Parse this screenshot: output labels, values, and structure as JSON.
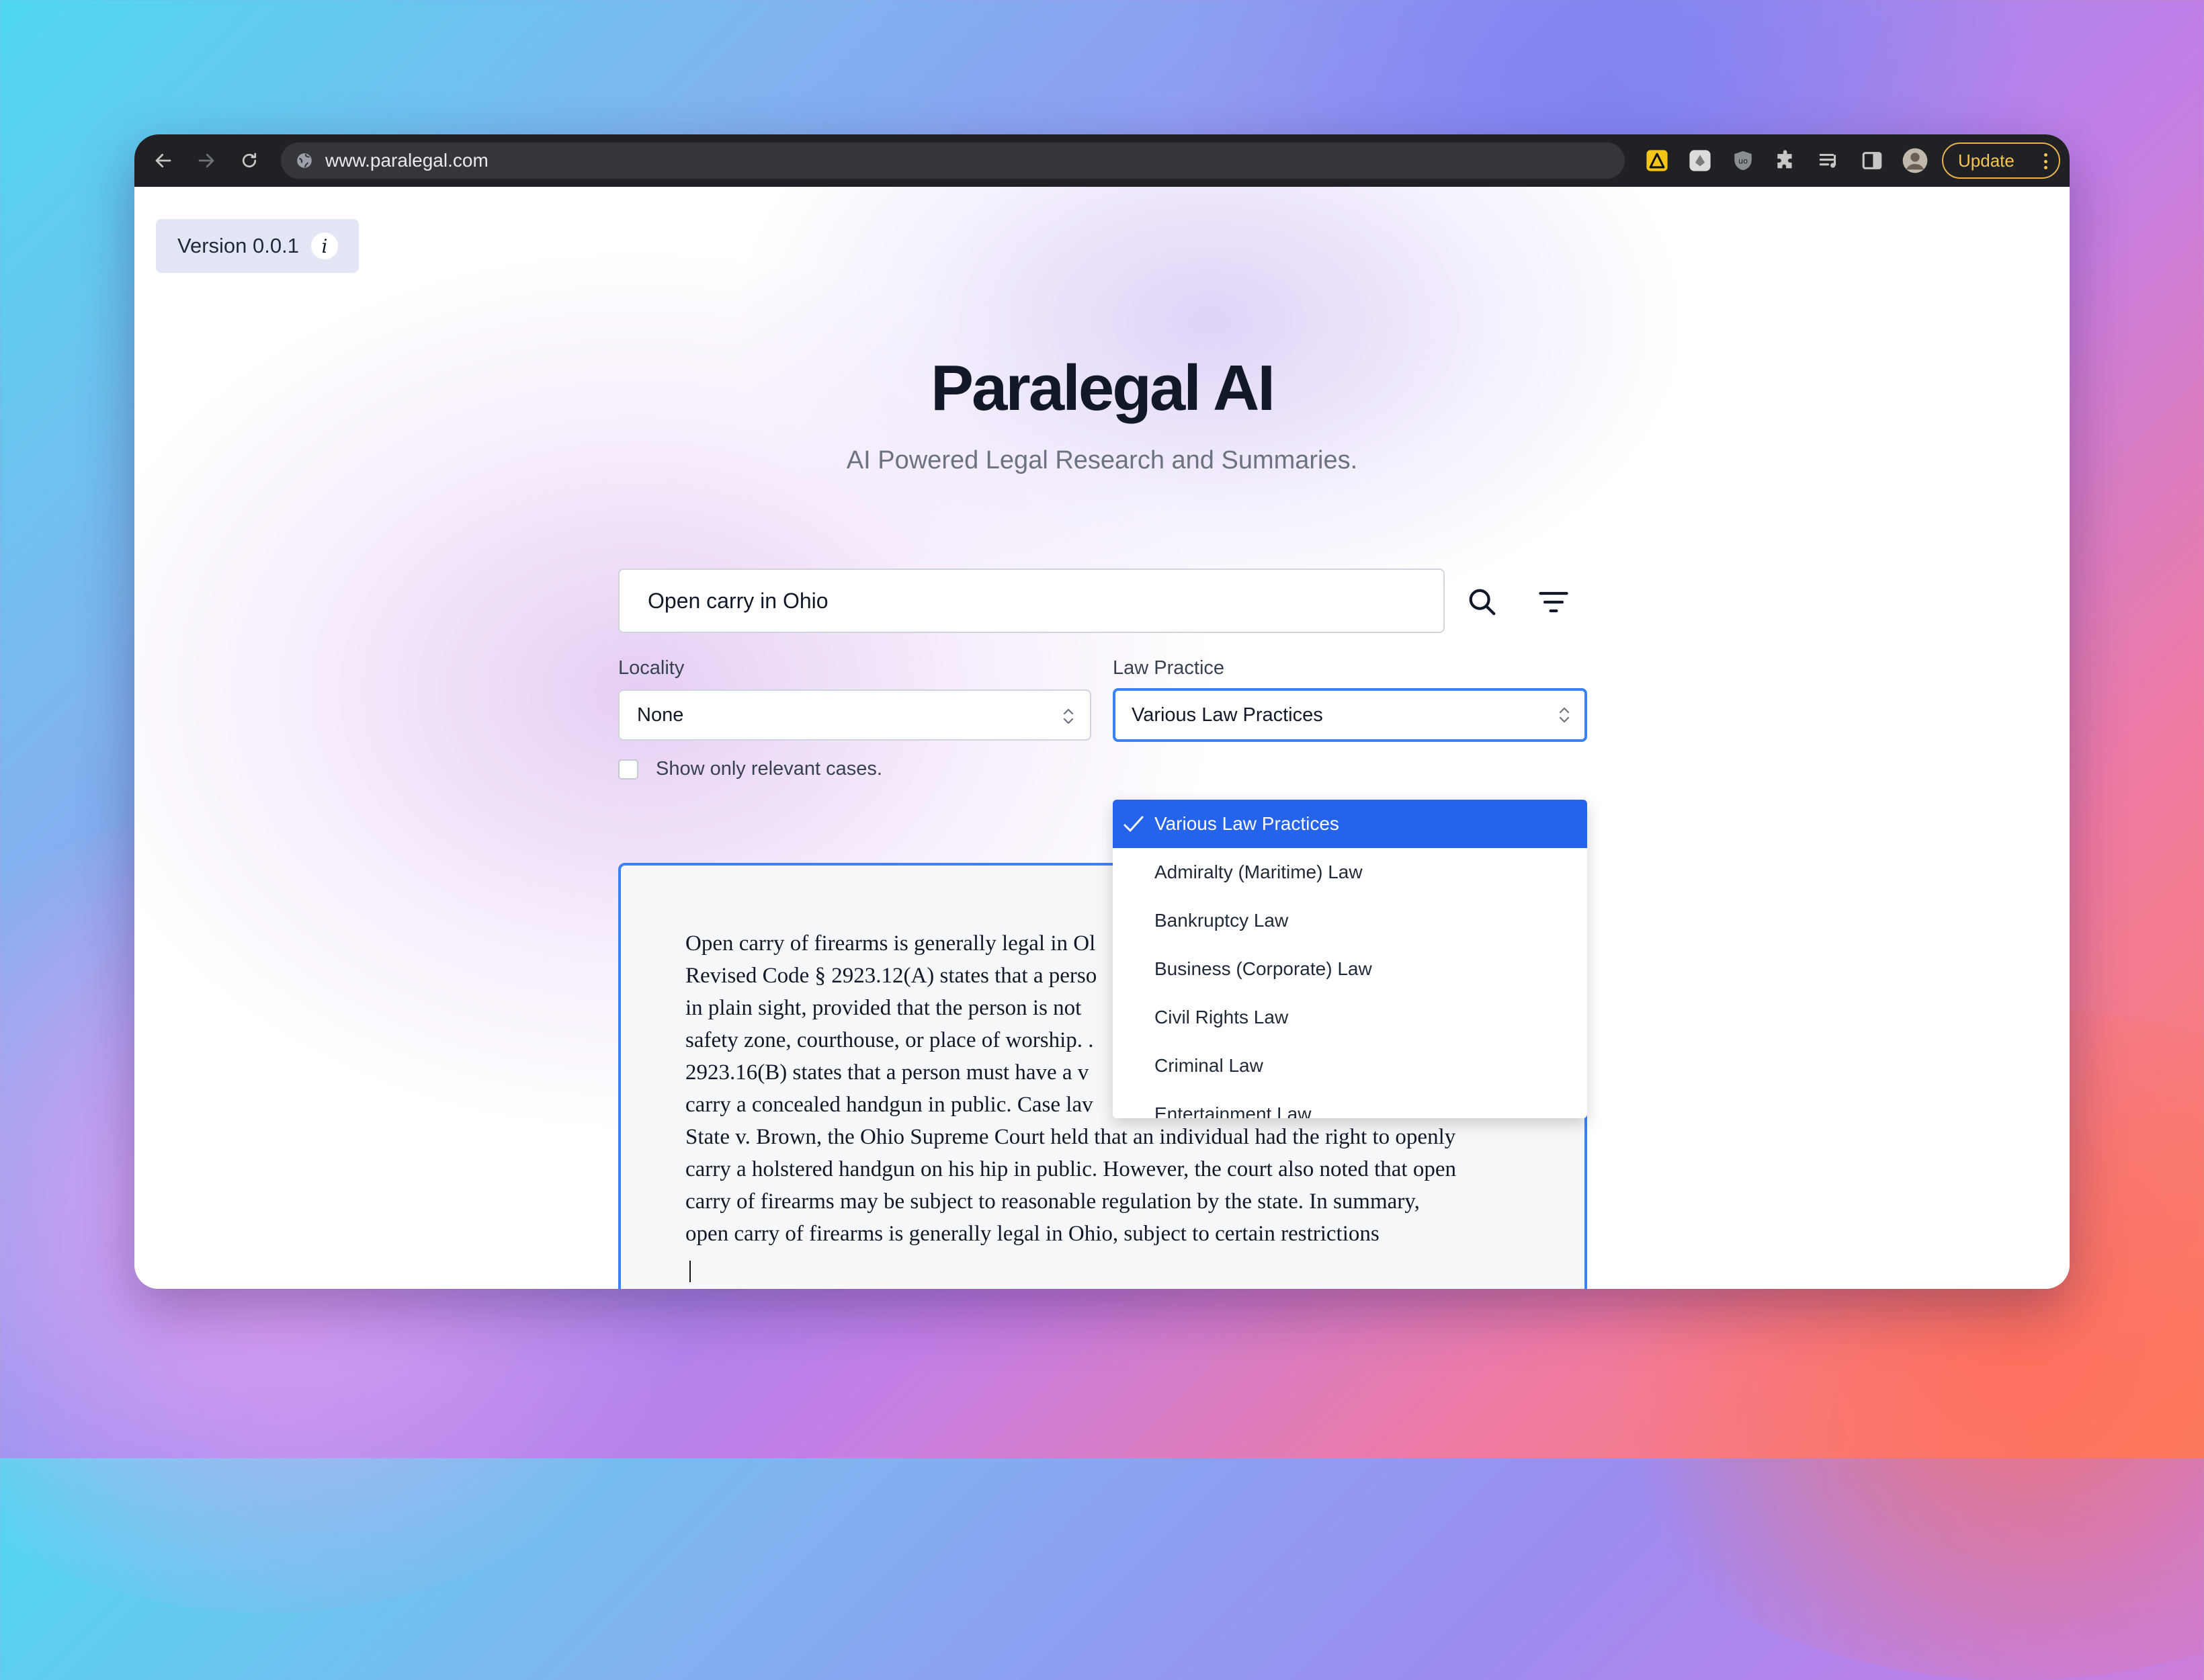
{
  "browser": {
    "url": "www.paralegal.com",
    "update_label": "Update"
  },
  "app": {
    "version_label": "Version 0.0.1",
    "info_glyph": "i",
    "title": "Paralegal AI",
    "subtitle": "AI Powered Legal Research and Summaries."
  },
  "search": {
    "query": "Open carry in Ohio"
  },
  "filters": {
    "locality_label": "Locality",
    "locality_value": "None",
    "practice_label": "Law Practice",
    "practice_value": "Various Law Practices",
    "relevant_only_label": "Show only relevant cases.",
    "relevant_only_checked": false
  },
  "practice_options": [
    {
      "label": "Various Law Practices",
      "selected": true
    },
    {
      "label": "Admiralty (Maritime) Law",
      "selected": false
    },
    {
      "label": "Bankruptcy Law",
      "selected": false
    },
    {
      "label": "Business (Corporate) Law",
      "selected": false
    },
    {
      "label": "Civil Rights Law",
      "selected": false
    },
    {
      "label": "Criminal Law",
      "selected": false
    },
    {
      "label": "Entertainment Law",
      "selected": false
    }
  ],
  "result": {
    "lines": [
      "Open carry of firearms is generally legal in Ol",
      "Revised Code § 2923.12(A) states that a perso",
      "in plain sight, provided that the person is not",
      "safety zone, courthouse, or place of worship. .",
      "2923.16(B) states that a person must have a v",
      "carry a concealed handgun in public. Case lav",
      "State v. Brown, the Ohio Supreme Court held that an individual had the right to openly",
      "carry a holstered handgun on his hip in public. However, the court also noted that open",
      "carry of firearms may be subject to reasonable regulation by the state. In summary,",
      "open carry of firearms is generally legal in Ohio, subject to certain restrictions"
    ]
  },
  "colors": {
    "accent": "#2563eb",
    "focus_border": "#3b82f6",
    "title": "#111827",
    "update": "#f6c453"
  }
}
